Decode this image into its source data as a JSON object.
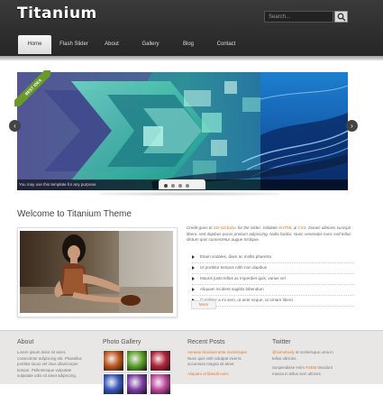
{
  "header": {
    "logo": "Titanium",
    "search_placeholder": "Search..."
  },
  "nav": {
    "items": [
      {
        "label": "Home",
        "active": true
      },
      {
        "label": "Flash Slider",
        "active": false
      },
      {
        "label": "About",
        "active": false
      },
      {
        "label": "Gallery",
        "active": false
      },
      {
        "label": "Blog",
        "active": false
      },
      {
        "label": "Contact",
        "active": false
      }
    ]
  },
  "slider": {
    "ribbon": "BEST IDEA",
    "caption": "You may use this template for any purpose.",
    "dots": 4,
    "active_dot": 1,
    "prev_glyph": "‹",
    "next_glyph": "›"
  },
  "main": {
    "title": "Welcome to Titanium Theme",
    "intro_prefix": "Credit goes to ",
    "intro_link1": "Ste Nickalus",
    "intro_mid": " for the slider. Validate ",
    "intro_link2": "XHTML",
    "intro_amp": " & ",
    "intro_link3": "CSS",
    "intro_suffix": ". Donec ultricies suscipit libero, sed dapibus purus pretium adipiscing. Nulla facilisi. Nunc venenatis nunc sed tellus dictum quis consectetur augue tristique.",
    "bullets": [
      "Etiam sodales, diam ac mollis pharetra",
      "Ut porttitor tempus nibh non dapibus",
      "Mauris justo tellus ac imperdiet quis, varius vel",
      "Aliquam incident sagittis bibendum",
      "Curabitur a mi sem, ut ante neque, ut ornare libero"
    ],
    "more": "More"
  },
  "footer": {
    "about_title": "About",
    "about_text": [
      "Lorem ipsum dolor sit amet,",
      "consectetur adipiscing elit. Phasellus",
      "porttitor lacus vel risus ullamcorper",
      "tempor. Pellentesque vulputate",
      "vulputate odio sit amet adipiscing."
    ],
    "gallery_title": "Photo Gallery",
    "gallery_colors": [
      "#c2571f",
      "#5da32a",
      "#b3243a",
      "#3a5bc0",
      "#7f3fa8",
      "#c24aa0"
    ],
    "recent_title": "Recent Posts",
    "recent_posts": [
      {
        "title": "Aenean tincidunt ante scelerisque",
        "text": "Nunc quis velit volutpat viverra",
        "text2": "accumsan magna sit amet."
      },
      {
        "title": "Aliquam ut blandit nunc",
        "text": "",
        "text2": ""
      }
    ],
    "twitter_title": "Twitter",
    "tweets": [
      {
        "handle": "@somebody",
        "text": " at scelerisque urna in",
        "text2": "tellus ultricies."
      },
      {
        "handle": "",
        "text": "Suspendisse enim ",
        "link": "#4455",
        "text2": " tincidunt",
        "text3": "massa in tellus sem ultrices."
      }
    ]
  }
}
